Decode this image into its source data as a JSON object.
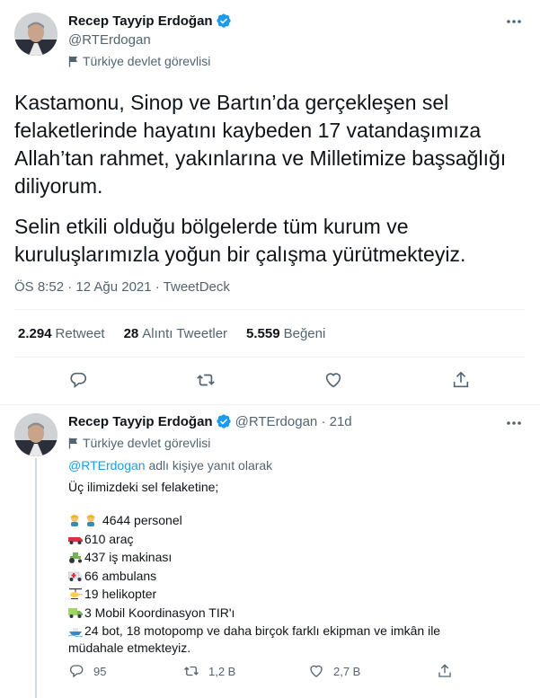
{
  "tweet": {
    "author_name": "Recep Tayyip Erdoğan",
    "handle": "@RTErdogan",
    "gov_label": "Türkiye devlet görevlisi",
    "text_p1": "Kastamonu, Sinop ve Bartın’da gerçekleşen sel felaketlerinde hayatını kaybeden 17 vatandaşımıza Allah’tan rahmet, yakınlarına ve Milletimize başsağlığı diliyorum.",
    "text_p2": "Selin etkili olduğu bölgelerde tüm kurum ve kuruluşlarımızla yoğun bir çalışma yürütmekteyiz.",
    "timestamp": "ÖS 8:52 · 12 Ağu 2021 · TweetDeck",
    "stats": {
      "retweets_count": "2.294",
      "retweets_label": "Retweet",
      "quotes_count": "28",
      "quotes_label": "Alıntı Tweetler",
      "likes_count": "5.559",
      "likes_label": "Beğeni"
    }
  },
  "reply": {
    "author_name": "Recep Tayyip Erdoğan",
    "handle_time": "@RTErdogan · 21d",
    "gov_label": "Türkiye devlet görevlisi",
    "reply_to_handle": "@RTErdogan",
    "reply_to_suffix": " adlı kişiye yanıt olarak",
    "intro": "Üç ilimizdeki sel felaketine;",
    "lines": [
      {
        "icon": "workers-emoji",
        "text": "4644 personel"
      },
      {
        "icon": "pickup-truck-emoji",
        "text": "610 araç"
      },
      {
        "icon": "tractor-emoji",
        "text": "437 iş makinası"
      },
      {
        "icon": "ambulance-emoji",
        "text": "66 ambulans"
      },
      {
        "icon": "helicopter-emoji",
        "text": "19 helikopter"
      },
      {
        "icon": "truck-emoji",
        "text": "3 Mobil Koordinasyon TIR'ı"
      },
      {
        "icon": "boat-emoji",
        "text": "24 bot, 18 motopomp ve daha birçok farklı ekipman ve imkân ile müdahale etmekteyiz."
      }
    ],
    "actions": {
      "replies": "95",
      "retweets": "1,2 B",
      "likes": "2,7 B"
    }
  },
  "colors": {
    "accent": "#1d9bf0",
    "text": "#0f1419",
    "muted": "#536471",
    "divider": "#eff3f4"
  }
}
